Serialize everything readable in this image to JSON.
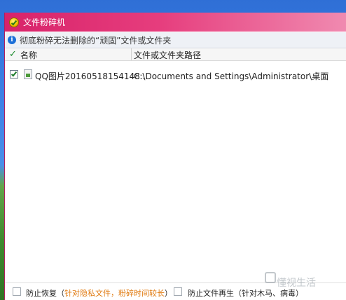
{
  "window": {
    "title": "文件粉碎机"
  },
  "info": {
    "text": "彻底粉碎无法删除的“顽固”文件或文件夹"
  },
  "table": {
    "columns": [
      "名称",
      "文件或文件夹路径"
    ],
    "rows": [
      {
        "checked": true,
        "name": "QQ图片20160518154148...",
        "path": "C:\\Documents and Settings\\Administrator\\桌面"
      }
    ]
  },
  "options": {
    "prevent_recover_label": "防止恢复",
    "prevent_recover_note": "针对隐私文件，粉碎时间较长",
    "prevent_regen_label": "防止文件再生",
    "prevent_regen_note": "针对木马、病毒",
    "paren_open": "（",
    "paren_close": "）"
  },
  "watermark": {
    "text": "懂视生活"
  },
  "colors": {
    "titlebar": "#e63d7d",
    "accent_orange": "#e07a10",
    "info_icon": "#1b6fd8"
  }
}
